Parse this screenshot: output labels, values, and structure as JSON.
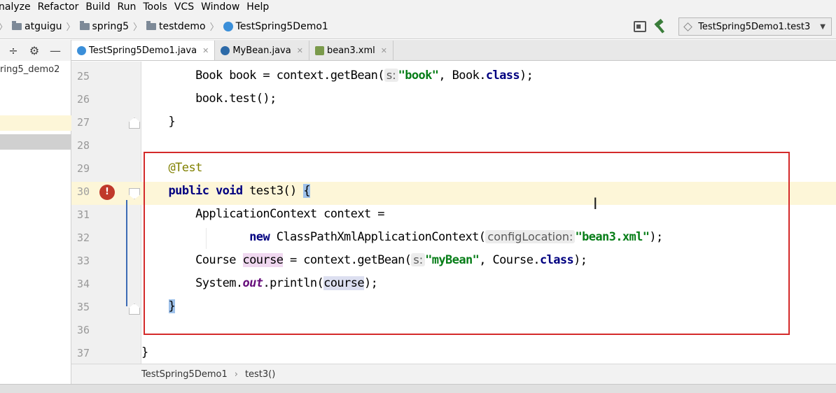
{
  "menu": [
    {
      "label": "nalyze",
      "id": "analyze"
    },
    {
      "label": "Refactor",
      "id": "refactor"
    },
    {
      "label": "Build",
      "id": "build"
    },
    {
      "label": "Run",
      "id": "run"
    },
    {
      "label": "Tools",
      "id": "tools"
    },
    {
      "label": "VCS",
      "id": "vcs"
    },
    {
      "label": "Window",
      "id": "window"
    },
    {
      "label": "Help",
      "id": "help"
    }
  ],
  "breadcrumbs": [
    "atguigu",
    "spring5",
    "testdemo",
    "TestSpring5Demo1"
  ],
  "run_config": "TestSpring5Demo1.test3",
  "project_root": "ring5_demo2",
  "tabs": [
    {
      "label": "TestSpring5Demo1.java",
      "active": true
    },
    {
      "label": "MyBean.java",
      "active": false
    },
    {
      "label": "bean3.xml",
      "active": false
    }
  ],
  "code": {
    "l25_a": "        Book book = context.getBean(",
    "l25_hint": "s:",
    "l25_str": "\"book\"",
    "l25_b": ", Book.",
    "l25_kw": "class",
    "l25_c": ");",
    "l26": "        book.test();",
    "l27": "    }",
    "l29": "    @Test",
    "l30_kw": "public void",
    "l30_a": " test3() ",
    "l30_brace": "{",
    "l31": "        ApplicationContext context =",
    "l32_kw": "new",
    "l32_a": " ClassPathXmlApplicationContext(",
    "l32_hint": "configLocation:",
    "l32_str": "\"bean3.xml\"",
    "l32_c": ");",
    "l33_a": "        Course ",
    "l33_var": "course",
    "l33_b": " = context.getBean(",
    "l33_hint": "s:",
    "l33_str": "\"myBean\"",
    "l33_c": ", Course.",
    "l33_kw": "class",
    "l33_d": ");",
    "l34_a": "        System.",
    "l34_fld": "out",
    "l34_b": ".println(",
    "l34_var": "course",
    "l34_c": ");",
    "l35_brace": "}",
    "l37": "}"
  },
  "line_numbers": [
    "25",
    "26",
    "27",
    "28",
    "29",
    "30",
    "31",
    "32",
    "33",
    "34",
    "35",
    "36",
    "37"
  ],
  "editor_breadcrumb": [
    "TestSpring5Demo1",
    "test3()"
  ]
}
